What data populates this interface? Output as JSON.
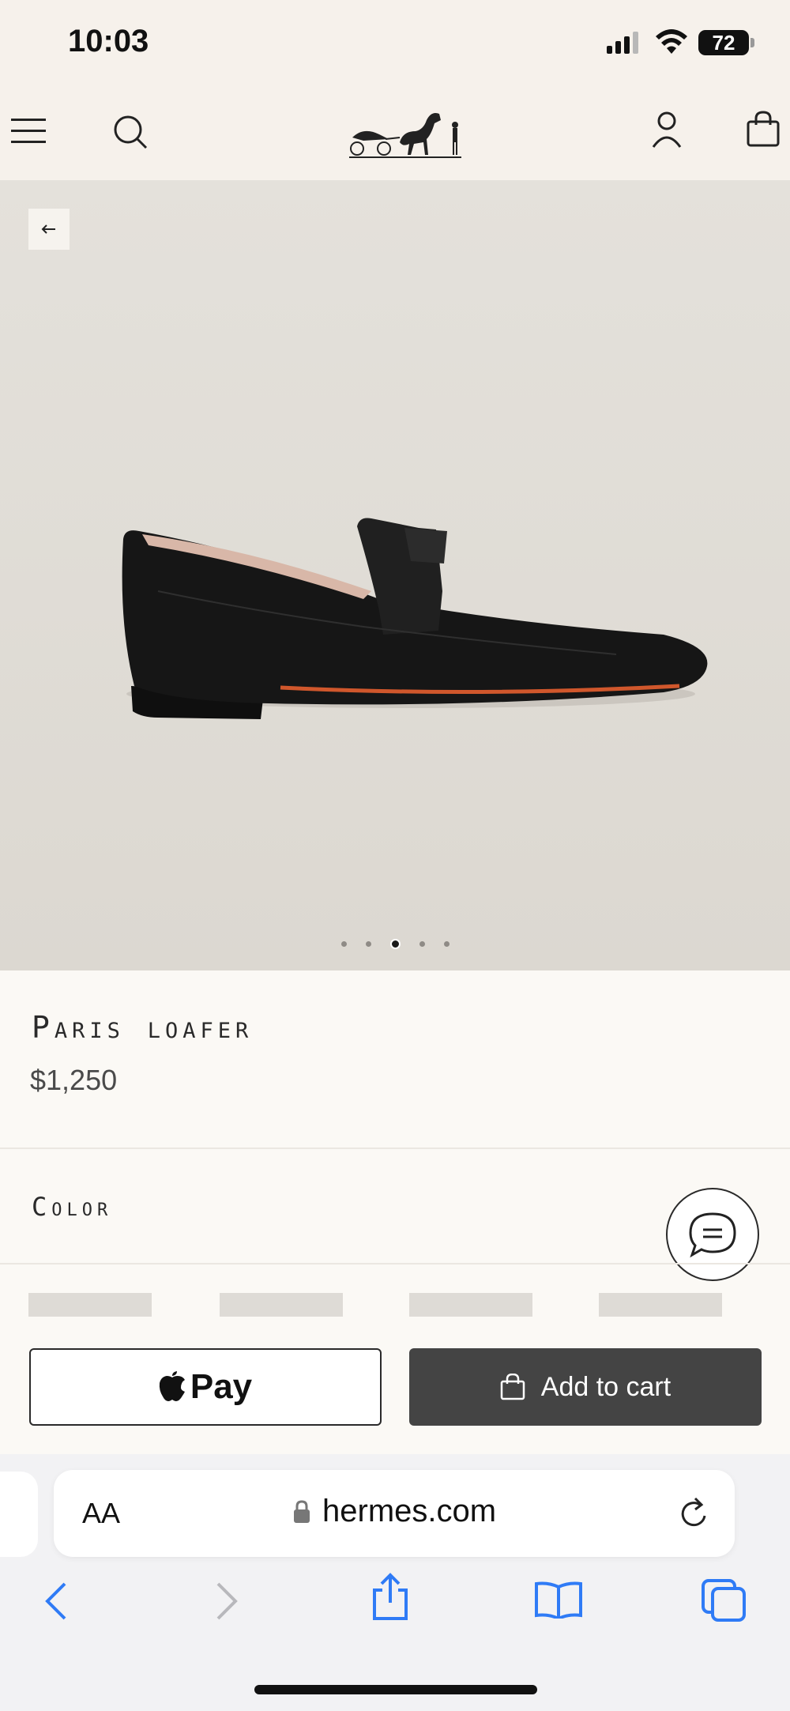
{
  "status_bar": {
    "time": "10:03",
    "battery": "72"
  },
  "header": {
    "menu_icon": "hamburger-icon",
    "search_icon": "search-icon",
    "logo": "hermes-carriage-logo",
    "account_icon": "account-icon",
    "bag_icon": "shopping-bag-icon"
  },
  "gallery": {
    "slide_count": 5,
    "active_index": 2
  },
  "product": {
    "name": "Paris loafer",
    "price": "$1,250"
  },
  "color_section": {
    "label": "Color"
  },
  "buttons": {
    "apple_pay_label": "Pay",
    "add_to_cart_label": "Add to cart"
  },
  "browser": {
    "text_size_label": "AA",
    "domain": "hermes.com"
  },
  "colors": {
    "hero_bg": "#e0ddd7",
    "cart_button": "#444444",
    "safari_blue": "#2f7bf6"
  }
}
